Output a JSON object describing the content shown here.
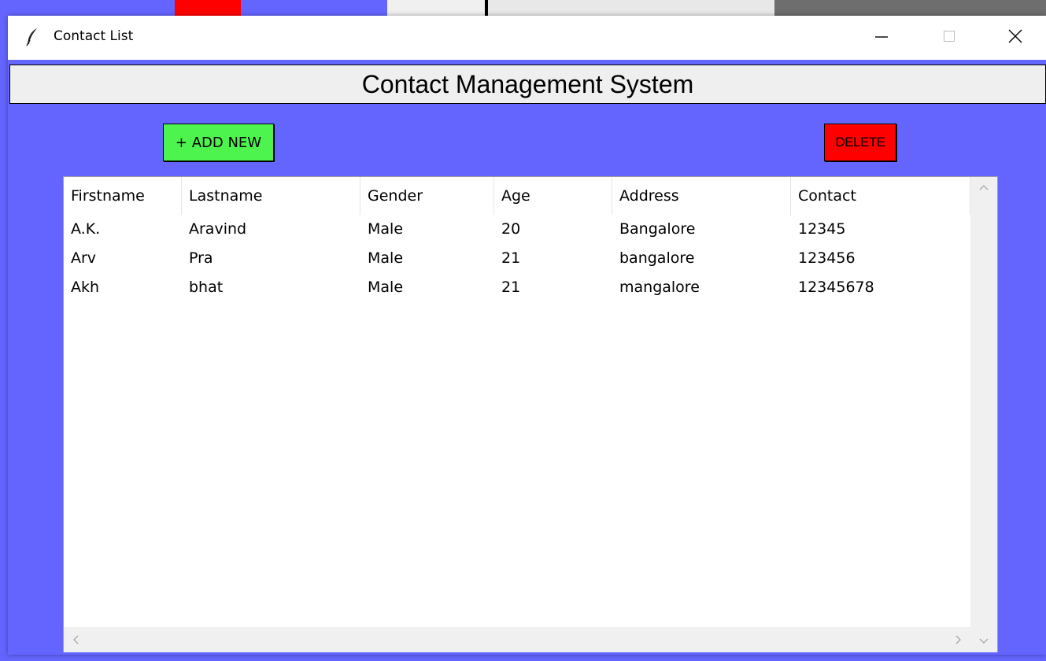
{
  "window": {
    "title": "Contact List"
  },
  "header": {
    "title": "Contact Management System"
  },
  "toolbar": {
    "add_label": "+ ADD NEW",
    "delete_label": "DELETE"
  },
  "table": {
    "columns": [
      "Firstname",
      "Lastname",
      "Gender",
      "Age",
      "Address",
      "Contact"
    ],
    "rows": [
      [
        "A.K.",
        "Aravind",
        "Male",
        "20",
        "Bangalore",
        "12345"
      ],
      [
        "Arv",
        "Pra",
        "Male",
        "21",
        "bangalore",
        "123456"
      ],
      [
        "Akh",
        "bhat",
        "Male",
        "21",
        "mangalore",
        "12345678"
      ]
    ]
  },
  "colors": {
    "background": "#6464ff",
    "add_button": "#4ef44e",
    "delete_button": "#ff0000",
    "header_bar": "#efefef"
  },
  "icons": {
    "app": "feather-icon",
    "minimize": "minimize-icon",
    "maximize": "maximize-icon",
    "close": "close-icon"
  }
}
